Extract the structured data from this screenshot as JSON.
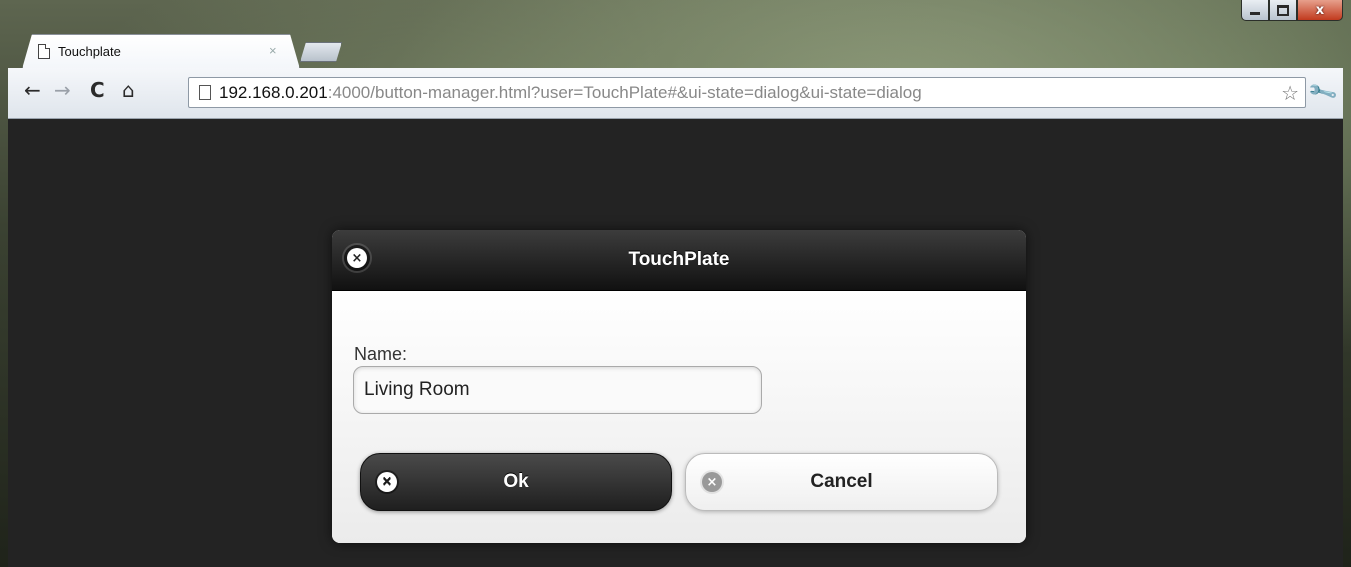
{
  "window": {
    "controls": {
      "minimize": "–",
      "maximize": "□",
      "close": "x"
    }
  },
  "tab": {
    "title": "Touchplate",
    "close": "×"
  },
  "toolbar": {
    "back": "←",
    "forward": "→",
    "reload": "C",
    "home": "⌂",
    "url_host": "192.168.0.201",
    "url_rest": ":4000/button-manager.html?user=TouchPlate#&ui-state=dialog&ui-state=dialog",
    "star": "☆",
    "wrench": "🔧"
  },
  "dialog": {
    "title": "TouchPlate",
    "close_glyph": "×",
    "name_label": "Name:",
    "name_value": "Living Room",
    "ok_label": "Ok",
    "cancel_label": "Cancel"
  }
}
